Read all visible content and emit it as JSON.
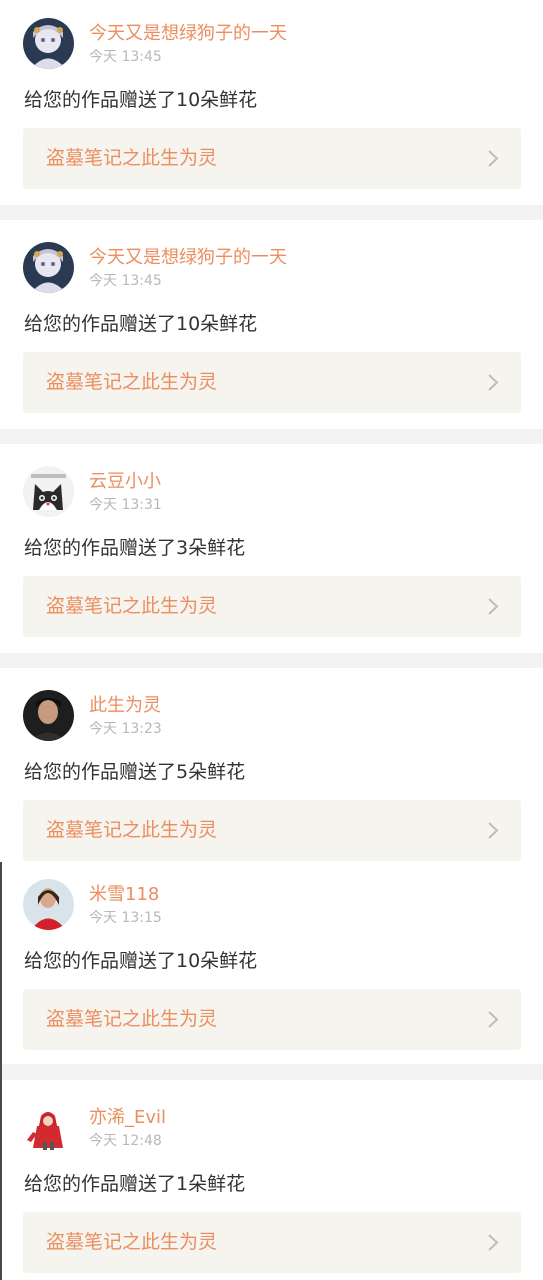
{
  "colors": {
    "accent": "#ec8e5f",
    "muted": "#b8b8b8",
    "text": "#333333",
    "card_bg": "#f5f4ee",
    "page_bg": "#f3f3f3"
  },
  "notifications": [
    {
      "username": "今天又是想绿狗子的一天",
      "time": "今天 13:45",
      "message": "给您的作品赠送了10朵鲜花",
      "work_title": "盗墓笔记之此生为灵",
      "avatar_icon": "anime-character-avatar"
    },
    {
      "username": "今天又是想绿狗子的一天",
      "time": "今天 13:45",
      "message": "给您的作品赠送了10朵鲜花",
      "work_title": "盗墓笔记之此生为灵",
      "avatar_icon": "anime-character-avatar"
    },
    {
      "username": "云豆小小",
      "time": "今天 13:31",
      "message": "给您的作品赠送了3朵鲜花",
      "work_title": "盗墓笔记之此生为灵",
      "avatar_icon": "cat-avatar"
    },
    {
      "username": "此生为灵",
      "time": "今天 13:23",
      "message": "给您的作品赠送了5朵鲜花",
      "work_title": "盗墓笔记之此生为灵",
      "avatar_icon": "person-photo-avatar"
    },
    {
      "username": "米雪118",
      "time": "今天 13:15",
      "message": "给您的作品赠送了10朵鲜花",
      "work_title": "盗墓笔记之此生为灵",
      "avatar_icon": "person-red-shirt-avatar"
    },
    {
      "username": "亦浠_Evil",
      "time": "今天 12:48",
      "message": "给您的作品赠送了1朵鲜花",
      "work_title": "盗墓笔记之此生为灵",
      "avatar_icon": "red-hoodie-figure-avatar"
    }
  ]
}
